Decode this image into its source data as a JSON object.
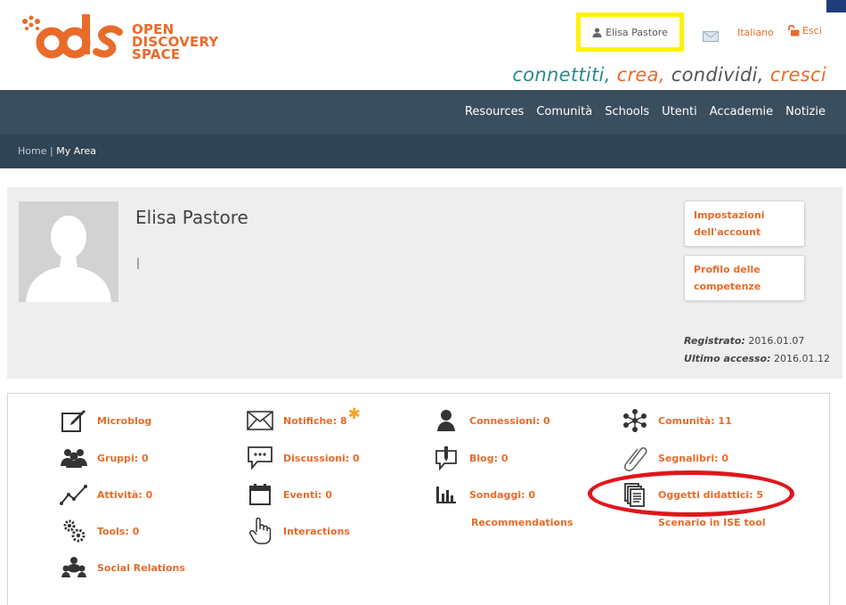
{
  "logo": {
    "line1": "OPEN",
    "line2": "DISCOVERY",
    "line3": "SPACE",
    "accent": "#e96b2a"
  },
  "header": {
    "user_name": "Elisa Pastore",
    "language": "Italiano",
    "logout": "Esci",
    "highlight_color": "#fff200",
    "tagline": {
      "w1": "connettiti,",
      "w2": "crea,",
      "w3": "condividi,",
      "w4": "cresci"
    }
  },
  "nav": {
    "items": [
      "Resources",
      "Comunità",
      "Schools",
      "Utenti",
      "Accademie",
      "Notizie"
    ],
    "bg": "#3b4e5e"
  },
  "breadcrumb": {
    "home": "Home",
    "sep": "|",
    "current": "My Area"
  },
  "profile": {
    "name": "Elisa Pastore",
    "status": "|",
    "buttons": {
      "account_l1": "Impostazioni",
      "account_l2": "dell'account",
      "skills_l1": "Profilo delle",
      "skills_l2": "competenze"
    },
    "registered_label": "Registrato:",
    "registered_value": "2016.01.07",
    "last_access_label": "Ultimo accesso:",
    "last_access_value": "2016.01.12"
  },
  "activities": {
    "microblog": "Microblog",
    "notifiche": "Notifiche: 8",
    "connessioni": "Connessioni: 0",
    "comunita": "Comunità: 11",
    "gruppi": "Gruppi: 0",
    "discussioni": "Discussioni: 0",
    "blog": "Blog: 0",
    "segnalibri": "Segnalibri: 0",
    "attivita": "Attività: 0",
    "eventi": "Eventi: 0",
    "sondaggi": "Sondaggi: 0",
    "oggetti": "Oggetti didattici: 5",
    "tools": "Tools: 0",
    "interactions": "Interactions",
    "recommendations": "Recommendations",
    "scenario": "Scenario in ISE tool",
    "social": "Social Relations",
    "notification_star": "✱",
    "highlight_ring_color": "#e0161c"
  }
}
